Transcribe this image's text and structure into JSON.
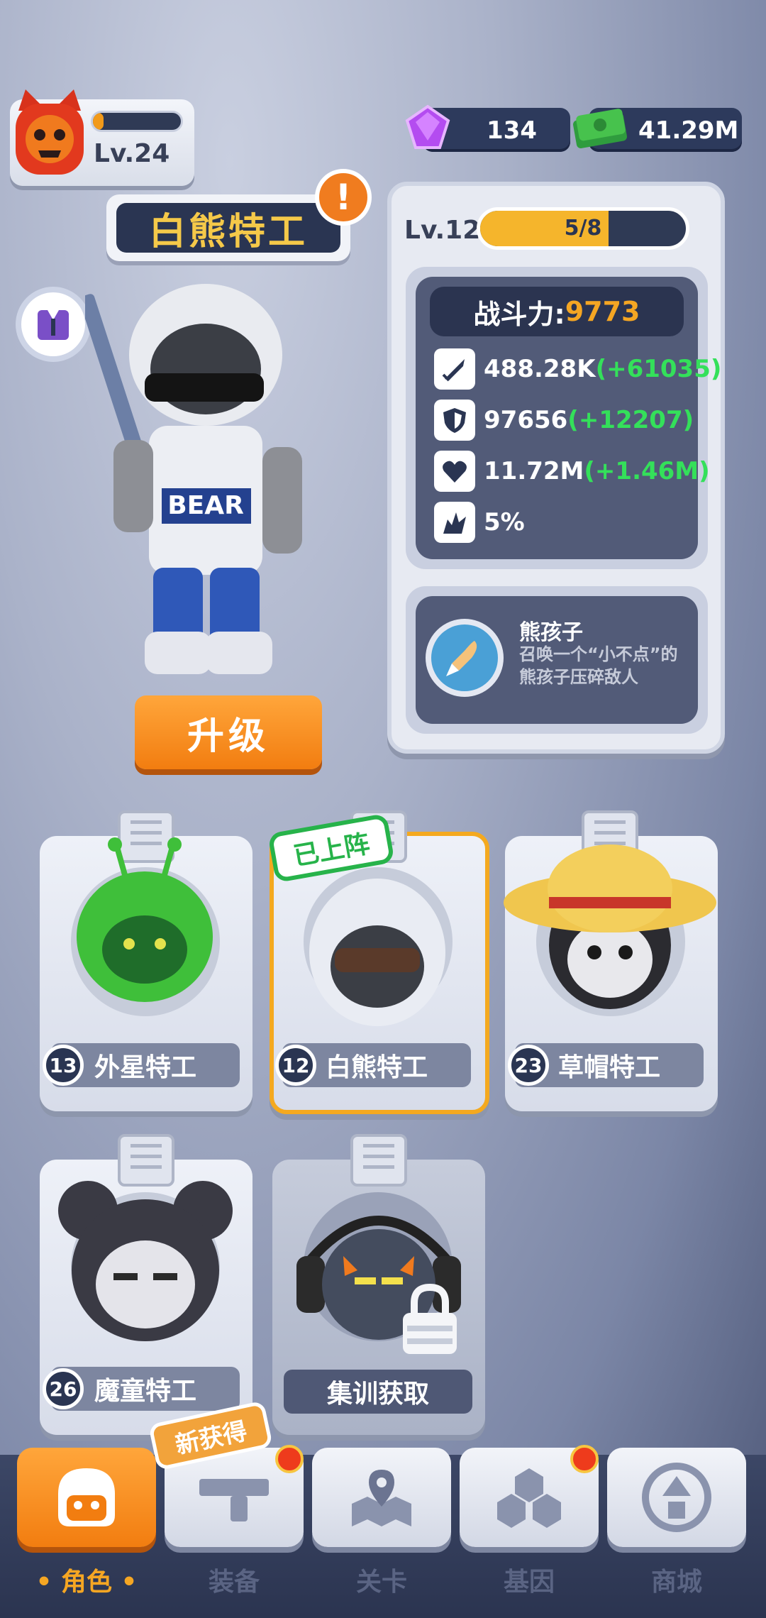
{
  "player": {
    "level": "Lv.24",
    "xp_fraction": 0.12
  },
  "currency": {
    "gems": "134",
    "cash": "41.29M"
  },
  "hero": {
    "name": "白熊特工",
    "alert": "!",
    "upgrade_label": "升级",
    "level": "Lv.12",
    "progress": "5/8",
    "progress_fraction": 0.625,
    "power_label": "战斗力:",
    "power_value": "9773",
    "stats": [
      {
        "icon": "attack-icon",
        "value": "488.28K",
        "bonus": "(+61035)"
      },
      {
        "icon": "defense-icon",
        "value": "97656",
        "bonus": "(+12207)"
      },
      {
        "icon": "health-icon",
        "value": "11.72M",
        "bonus": "(+1.46M)"
      },
      {
        "icon": "crit-icon",
        "value": "5%",
        "bonus": ""
      }
    ],
    "skill": {
      "name": "熊孩子",
      "description": "召唤一个“小不点”的熊孩子压碎敌人"
    }
  },
  "characters": [
    {
      "level": "13",
      "name": "外星特工",
      "color": "#3fbf3a"
    },
    {
      "level": "12",
      "name": "白熊特工",
      "color": "#e9ecf3",
      "deployed_label": "已上阵"
    },
    {
      "level": "23",
      "name": "草帽特工",
      "color": "#f0c64e"
    },
    {
      "level": "26",
      "name": "魔童特工",
      "color": "#3a3a44"
    },
    {
      "level": "",
      "name": "集训获取",
      "color": "#3e4a66"
    }
  ],
  "nav": {
    "new_tag": "新获得",
    "tabs": [
      "角色",
      "装备",
      "关卡",
      "基因",
      "商城"
    ]
  },
  "colors": {
    "accent": "#f27d10",
    "power": "#f5a623",
    "bonus": "#34e05a"
  }
}
